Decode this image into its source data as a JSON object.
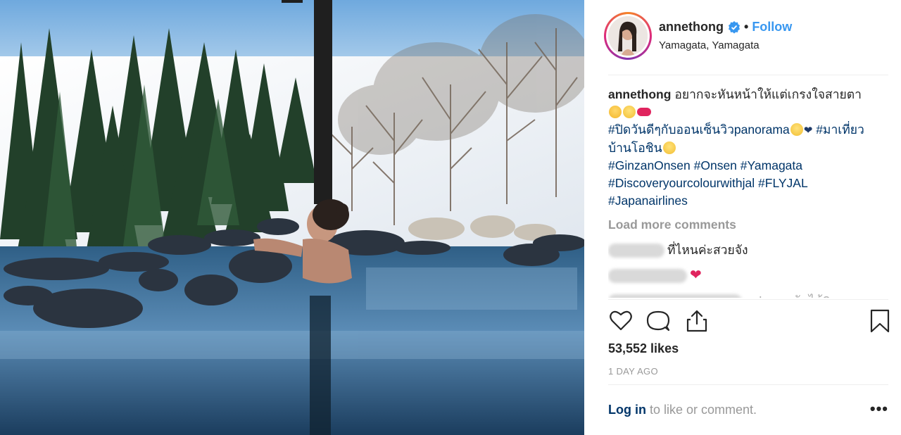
{
  "post": {
    "photo_icon": "onsen-photo",
    "username": "annethong",
    "verified_icon": "verified-badge-icon",
    "separator": "•",
    "follow_label": "Follow",
    "location": "Yamagata, Yamagata"
  },
  "caption": {
    "username": "annethong",
    "text_line1": "อยากจะหันหน้าให้แต่เกรงใจสายตา",
    "hashtag_1": "#ปิดวันดีๆกับออนเซ็นวิวpanorama",
    "hashtag_2": "#มาเที่ยวบ้านโอชิน",
    "hashtag_3": "#GinzanOnsen",
    "hashtag_4": "#Onsen",
    "hashtag_5": "#Yamagata",
    "hashtag_6": "#Discoveryourcolourwithjal",
    "hashtag_7": "#FLYJAL",
    "hashtag_8": "#Japanairlines"
  },
  "comments": {
    "load_more_label": "Load more comments",
    "items": [
      {
        "text": "ที่ไหนค่ะสวยจัง"
      },
      {
        "text": "❤"
      },
      {
        "text": "รอ! ...ขนกันไม้?"
      }
    ]
  },
  "actions": {
    "like_icon": "heart-icon",
    "comment_icon": "comment-icon",
    "share_icon": "share-icon",
    "save_icon": "bookmark-icon",
    "likes": "53,552 likes",
    "time_ago": "1 DAY AGO"
  },
  "footer": {
    "login_label": "Log in",
    "login_suffix": " to like or comment.",
    "more_label": "•••"
  },
  "colors": {
    "link_blue": "#3897f0",
    "hashtag_navy": "#003569",
    "muted_gray": "#999999"
  }
}
